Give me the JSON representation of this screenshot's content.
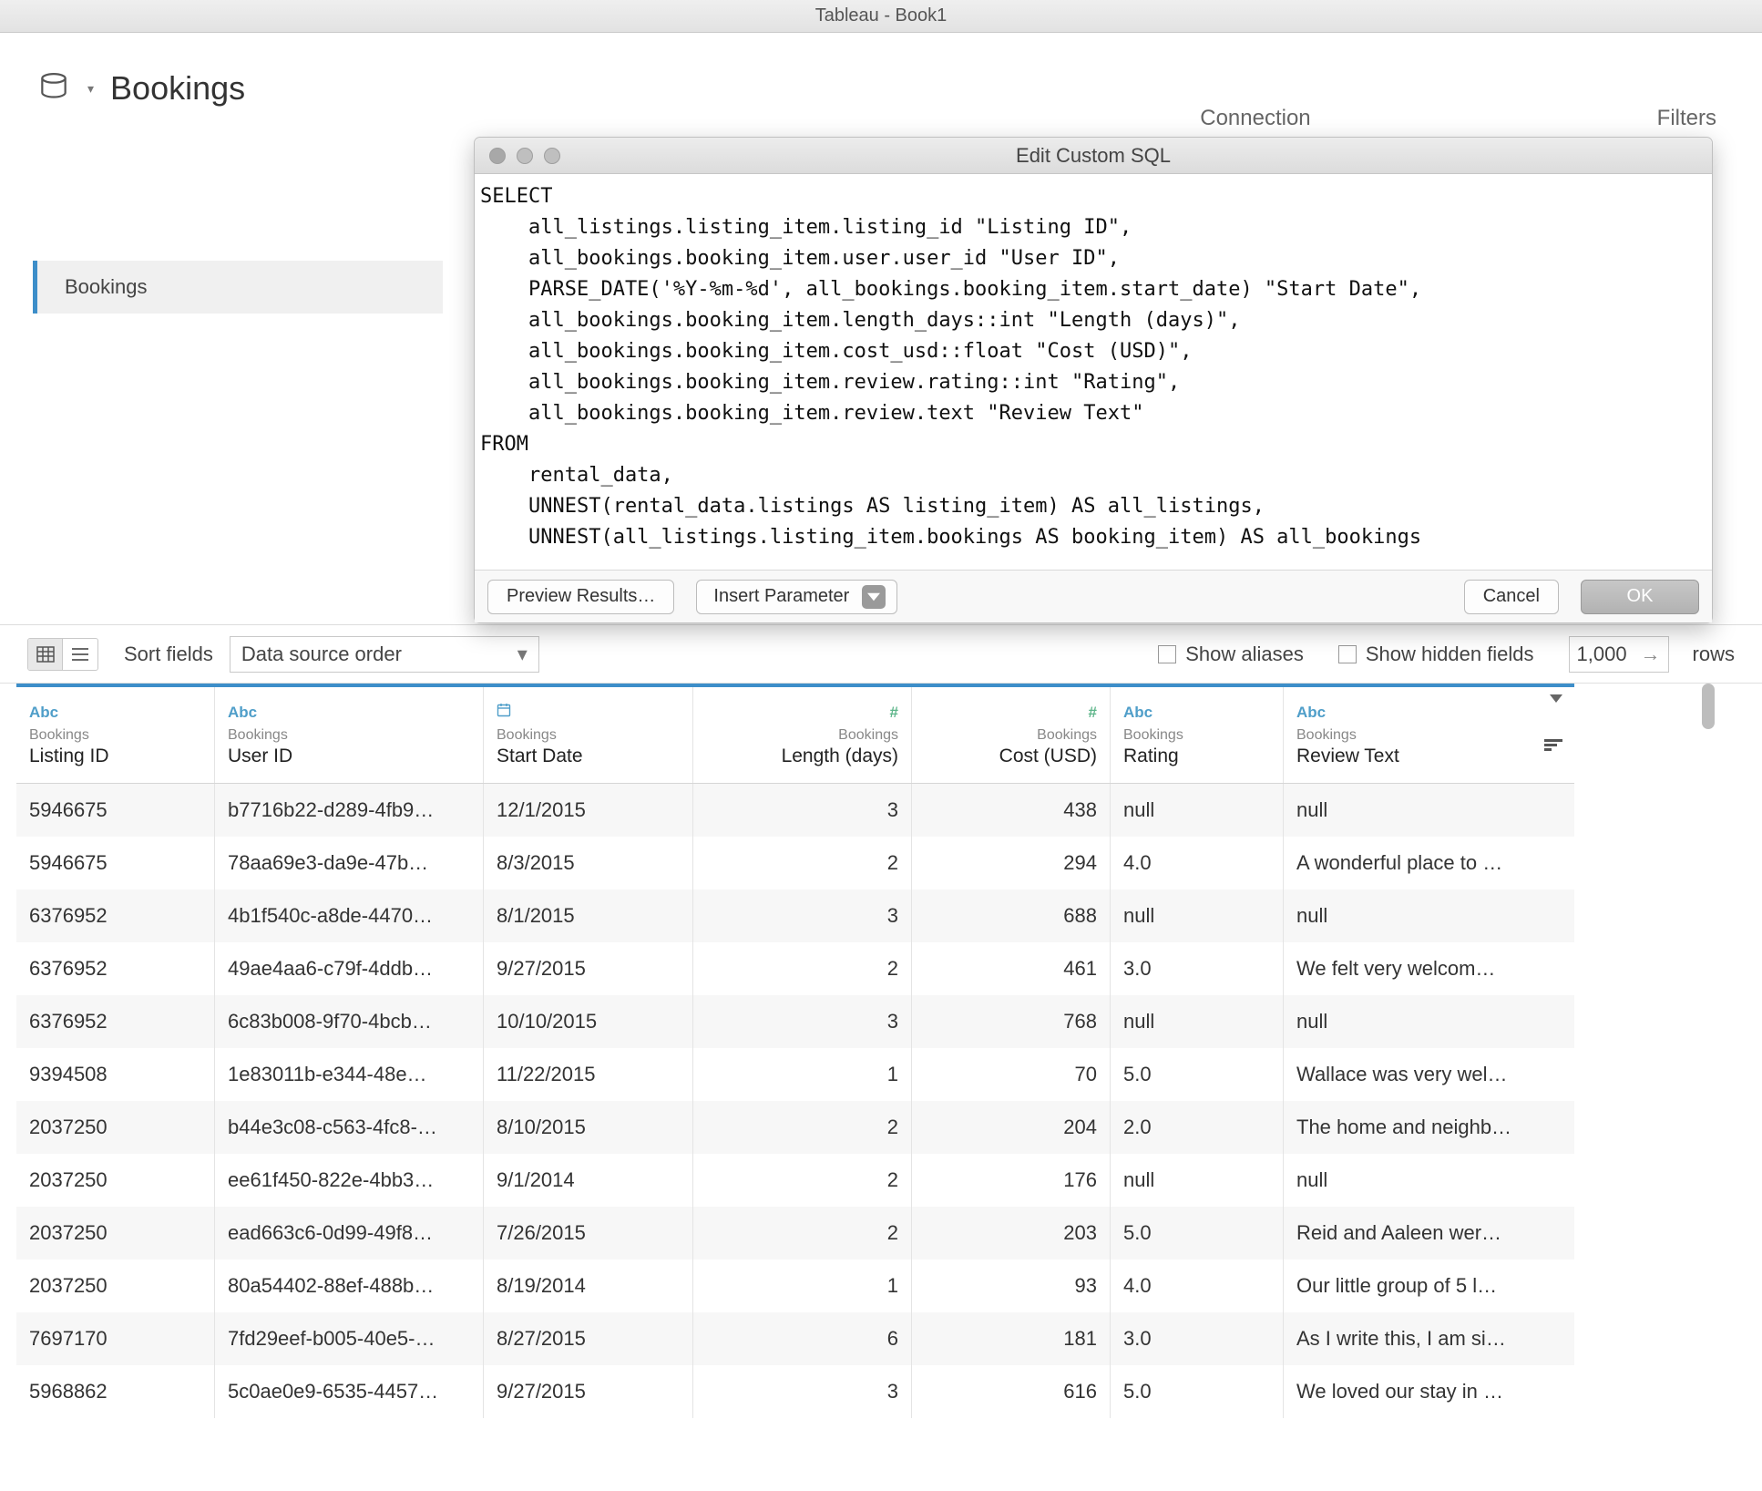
{
  "window": {
    "title": "Tableau - Book1"
  },
  "datasource": {
    "title": "Bookings"
  },
  "top_labels": {
    "connection": "Connection",
    "filters": "Filters"
  },
  "left_panel": {
    "item": "Bookings"
  },
  "dialog": {
    "title": "Edit Custom SQL",
    "sql": "SELECT\n    all_listings.listing_item.listing_id \"Listing ID\",\n    all_bookings.booking_item.user.user_id \"User ID\",\n    PARSE_DATE('%Y-%m-%d', all_bookings.booking_item.start_date) \"Start Date\",\n    all_bookings.booking_item.length_days::int \"Length (days)\",\n    all_bookings.booking_item.cost_usd::float \"Cost (USD)\",\n    all_bookings.booking_item.review.rating::int \"Rating\",\n    all_bookings.booking_item.review.text \"Review Text\"\nFROM\n    rental_data,\n    UNNEST(rental_data.listings AS listing_item) AS all_listings,\n    UNNEST(all_listings.listing_item.bookings AS booking_item) AS all_bookings",
    "preview": "Preview Results…",
    "insert_param": "Insert Parameter",
    "cancel": "Cancel",
    "ok": "OK"
  },
  "toolbar": {
    "sort_label": "Sort fields",
    "sort_value": "Data source order",
    "show_aliases": "Show aliases",
    "show_hidden": "Show hidden fields",
    "rows_value": "1,000",
    "rows_label": "rows"
  },
  "grid": {
    "source": "Bookings",
    "columns": [
      {
        "type": "Abc",
        "tclass": "abc-type",
        "name": "Listing ID"
      },
      {
        "type": "Abc",
        "tclass": "abc-type",
        "name": "User ID"
      },
      {
        "type": "date",
        "tclass": "date-type",
        "name": "Start Date"
      },
      {
        "type": "#",
        "tclass": "num-type",
        "name": "Length (days)"
      },
      {
        "type": "#",
        "tclass": "num-type",
        "name": "Cost (USD)"
      },
      {
        "type": "Abc",
        "tclass": "abc-type",
        "name": "Rating"
      },
      {
        "type": "Abc",
        "tclass": "abc-type",
        "name": "Review Text"
      }
    ],
    "rows": [
      [
        "5946675",
        "b7716b22-d289-4fb9…",
        "12/1/2015",
        "3",
        "438",
        "null",
        "null"
      ],
      [
        "5946675",
        "78aa69e3-da9e-47b…",
        "8/3/2015",
        "2",
        "294",
        "4.0",
        "A wonderful place to …"
      ],
      [
        "6376952",
        "4b1f540c-a8de-4470…",
        "8/1/2015",
        "3",
        "688",
        "null",
        "null"
      ],
      [
        "6376952",
        "49ae4aa6-c79f-4ddb…",
        "9/27/2015",
        "2",
        "461",
        "3.0",
        "We felt very welcom…"
      ],
      [
        "6376952",
        "6c83b008-9f70-4bcb…",
        "10/10/2015",
        "3",
        "768",
        "null",
        "null"
      ],
      [
        "9394508",
        "1e83011b-e344-48e…",
        "11/22/2015",
        "1",
        "70",
        "5.0",
        "Wallace was very wel…"
      ],
      [
        "2037250",
        "b44e3c08-c563-4fc8-…",
        "8/10/2015",
        "2",
        "204",
        "2.0",
        "The home and neighb…"
      ],
      [
        "2037250",
        "ee61f450-822e-4bb3…",
        "9/1/2014",
        "2",
        "176",
        "null",
        "null"
      ],
      [
        "2037250",
        "ead663c6-0d99-49f8…",
        "7/26/2015",
        "2",
        "203",
        "5.0",
        "Reid and Aaleen wer…"
      ],
      [
        "2037250",
        "80a54402-88ef-488b…",
        "8/19/2014",
        "1",
        "93",
        "4.0",
        "Our little group of 5 l…"
      ],
      [
        "7697170",
        "7fd29eef-b005-40e5-…",
        "8/27/2015",
        "6",
        "181",
        "3.0",
        "As I write this, I am si…"
      ],
      [
        "5968862",
        "5c0ae0e9-6535-4457…",
        "9/27/2015",
        "3",
        "616",
        "5.0",
        "We loved our stay in …"
      ]
    ]
  }
}
